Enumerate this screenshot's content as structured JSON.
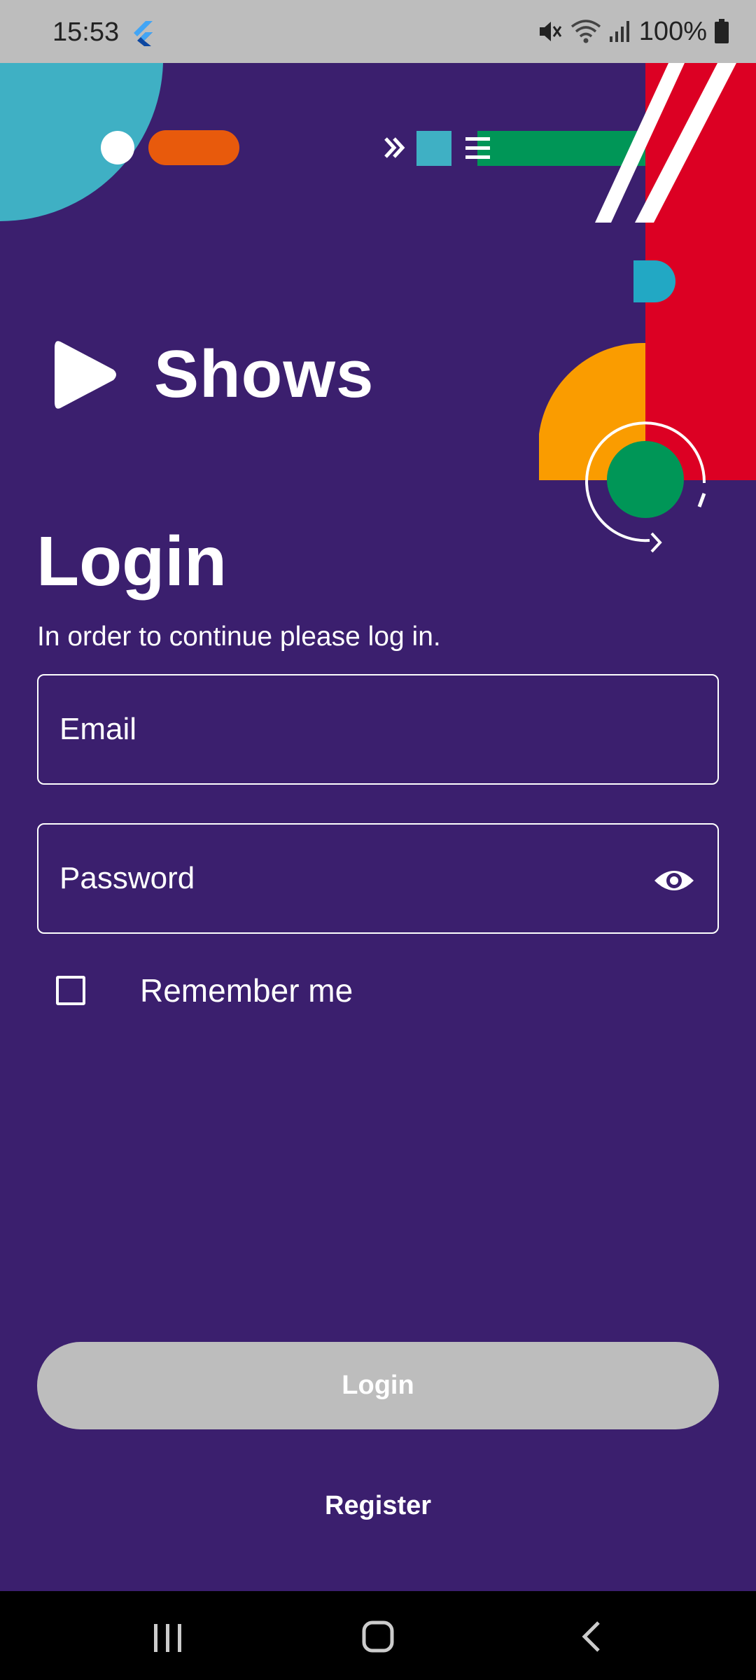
{
  "status_bar": {
    "time": "15:53",
    "battery": "100%",
    "icons": [
      "flutter-icon",
      "mute-icon",
      "wifi-icon",
      "signal-icon",
      "battery-icon"
    ]
  },
  "app": {
    "name": "Shows",
    "logo_icon": "play-icon"
  },
  "login": {
    "title": "Login",
    "subtitle": "In order to continue please log in.",
    "email_placeholder": "Email",
    "password_placeholder": "Password",
    "password_toggle_icon": "eye-icon",
    "remember_label": "Remember me",
    "remember_checked": false,
    "login_button": "Login",
    "login_enabled": false,
    "register_link": "Register"
  },
  "nav_bar": {
    "buttons": [
      "recents-icon",
      "home-icon",
      "back-icon"
    ]
  },
  "colors": {
    "background": "#3B1F6E",
    "button_disabled": "#BDBDBD",
    "status_bar": "#BDBDBD",
    "accent_teal": "#3FB0C4",
    "accent_orange": "#E85A0C",
    "accent_red": "#DC0023",
    "accent_green": "#009657",
    "accent_yellow": "#FA9C00"
  }
}
